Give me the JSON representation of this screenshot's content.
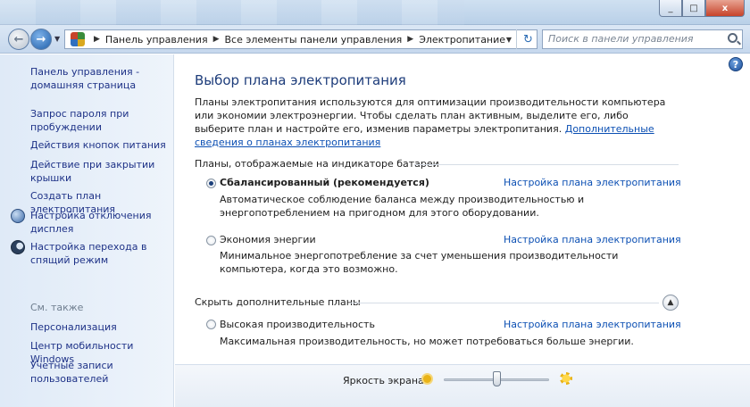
{
  "window": {
    "minimize": "_",
    "maximize": "□",
    "close": "x"
  },
  "address": {
    "crumbs": [
      "Панель управления",
      "Все элементы панели управления",
      "Электропитание"
    ]
  },
  "search": {
    "placeholder": "Поиск в панели управления"
  },
  "sidebar": {
    "links": [
      {
        "label": "Панель управления - домашняя страница",
        "icon": null
      },
      {
        "label": "Запрос пароля при пробуждении",
        "icon": null
      },
      {
        "label": "Действия кнопок питания",
        "icon": null
      },
      {
        "label": "Действие при закрытии крышки",
        "icon": null
      },
      {
        "label": "Создать план электропитания",
        "icon": null
      },
      {
        "label": "Настройка отключения дисплея",
        "icon": "monitor-icon"
      },
      {
        "label": "Настройка перехода в спящий режим",
        "icon": "moon-icon"
      }
    ],
    "see_also_heading": "См. также",
    "see_also": [
      "Персонализация",
      "Центр мобильности Windows",
      "Учетные записи пользователей"
    ]
  },
  "main": {
    "title": "Выбор плана электропитания",
    "intro_text": "Планы электропитания используются для оптимизации производительности компьютера или экономии электроэнергии. Чтобы сделать план активным, выделите его, либо выберите план и настройте его, изменив параметры электропитания.",
    "intro_link": "Дополнительные сведения о планах электропитания",
    "battery_group_heading": "Планы, отображаемые на индикаторе батареи",
    "hidden_group_heading": "Скрыть дополнительные планы",
    "plans": [
      {
        "name": "Сбалансированный (рекомендуется)",
        "selected": true,
        "description": "Автоматическое соблюдение баланса между производительностью и энергопотреблением на пригодном для этого оборудовании.",
        "link": "Настройка плана электропитания"
      },
      {
        "name": "Экономия энергии",
        "selected": false,
        "description": "Минимальное энергопотребление за счет уменьшения производительности компьютера, когда это возможно.",
        "link": "Настройка плана электропитания"
      },
      {
        "name": "Высокая производительность",
        "selected": false,
        "description": "Максимальная производительность, но может потребоваться больше энергии.",
        "link": "Настройка плана электропитания"
      }
    ]
  },
  "footer": {
    "brightness_label": "Яркость экрана:",
    "brightness_level": 0.5
  },
  "colors": {
    "link": "#0b4fb3",
    "title": "#1e3d7b",
    "sidebar_link": "#1e3287"
  }
}
